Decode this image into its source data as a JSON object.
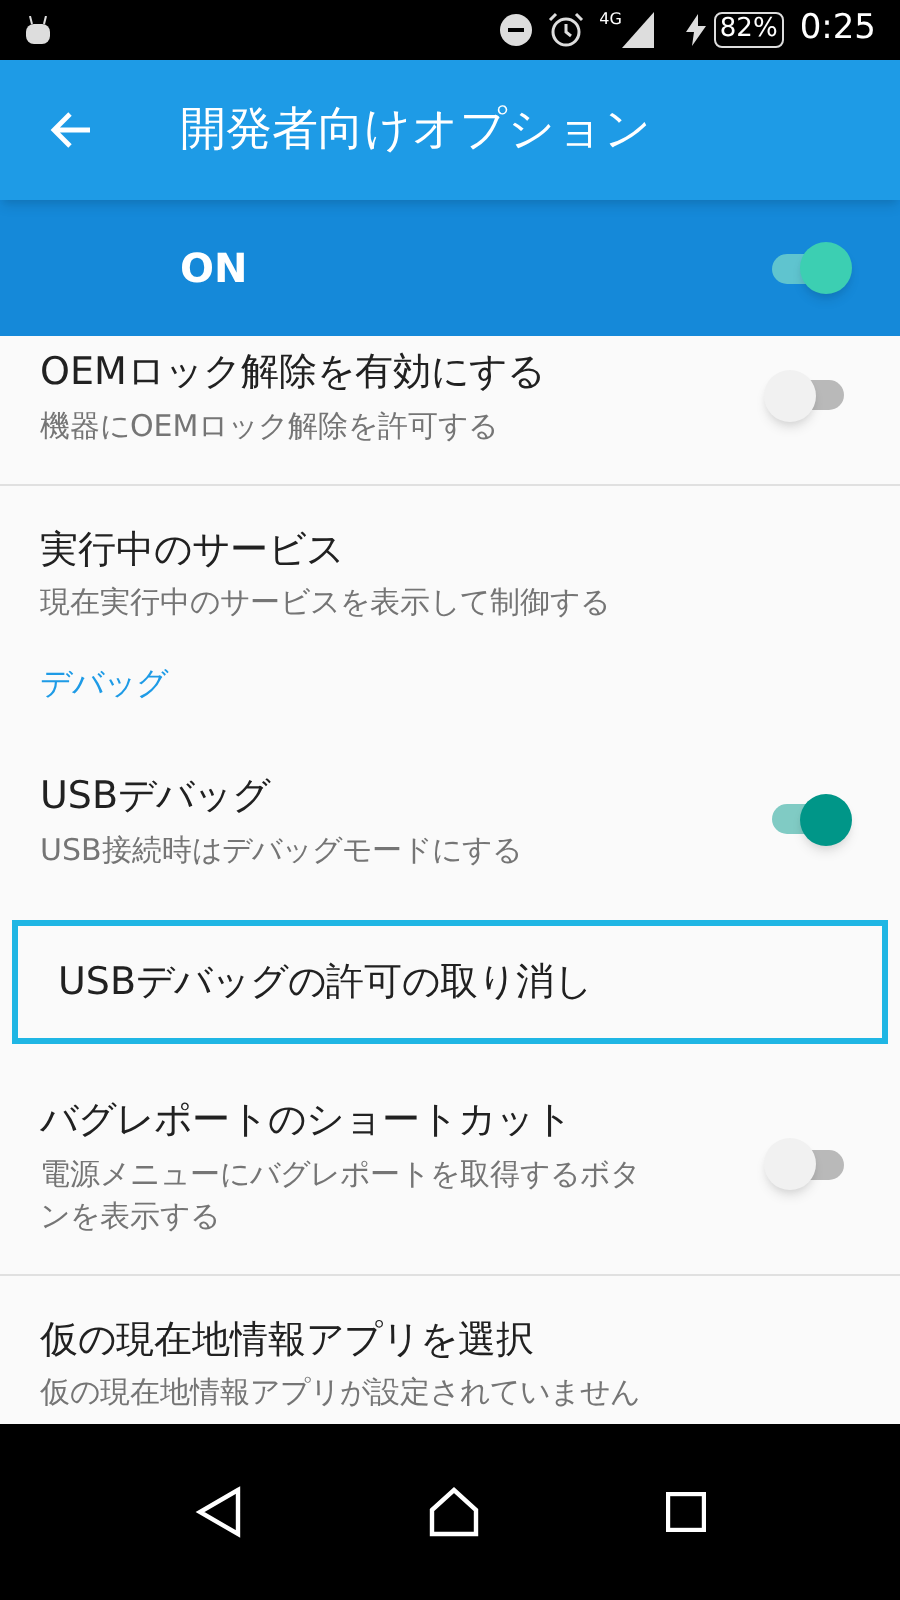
{
  "status_bar": {
    "network": "4G",
    "battery": "82%",
    "time": "0:25"
  },
  "app_bar": {
    "title": "開発者向けオプション"
  },
  "master_switch": {
    "label": "ON",
    "on": true
  },
  "list": [
    {
      "kind": "toggle",
      "title": "OEMロック解除を有効にする",
      "summary": "機器にOEMロック解除を許可する",
      "on": false,
      "focused": false
    },
    {
      "kind": "setting",
      "title": "実行中のサービス",
      "summary": "現在実行中のサービスを表示して制御する",
      "focused": false
    },
    {
      "kind": "category",
      "title": "デバッグ"
    },
    {
      "kind": "toggle",
      "title": "USBデバッグ",
      "summary": "USB接続時はデバッグモードにする",
      "on": true,
      "focused": false
    },
    {
      "kind": "setting",
      "title": "USBデバッグの許可の取り消し",
      "focused": true
    },
    {
      "kind": "toggle",
      "title": "バグレポートのショートカット",
      "summary": "電源メニューにバグレポートを取得するボタンを表示する",
      "on": false,
      "focused": false
    },
    {
      "kind": "setting",
      "title": "仮の現在地情報アプリを選択",
      "summary": "仮の現在地情報アプリが設定されていません",
      "focused": false
    }
  ]
}
